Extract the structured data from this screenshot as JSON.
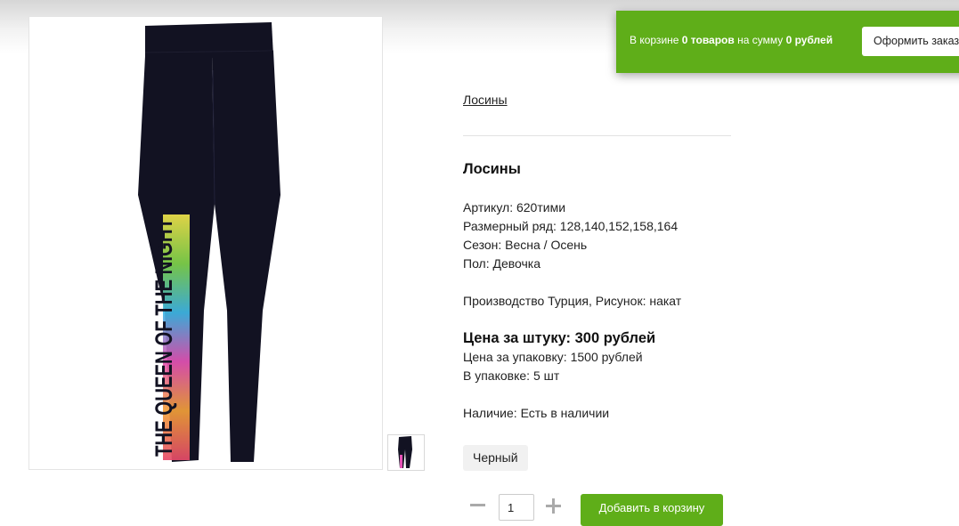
{
  "cart": {
    "prefix": "В корзине ",
    "items": "0 товаров",
    "middle": " на сумму ",
    "sum": "0 рублей",
    "checkout_label": "Оформить заказ"
  },
  "product": {
    "breadcrumb": "Лосины",
    "title": "Лосины",
    "article": "Артикул: 620тими",
    "sizes": "Размерный ряд: 128,140,152,158,164",
    "season": "Сезон: Весна / Осень",
    "gender": "Пол: Девочка",
    "origin": "Производство Турция, Рисунок: накат",
    "price_unit": "Цена за штуку: 300 рублей",
    "price_pack": "Цена за упаковку: 1500 рублей",
    "pack_qty": "В упаковке: 5 шт",
    "availability": "Наличие: Есть в наличии",
    "color": "Черный",
    "print_text": "THE QUEEN OF THE NIGHT",
    "quantity": "1",
    "add_to_cart_label": "Добавить в корзину"
  },
  "colors": {
    "accent": "#5fae19",
    "leggings": "#121222"
  }
}
